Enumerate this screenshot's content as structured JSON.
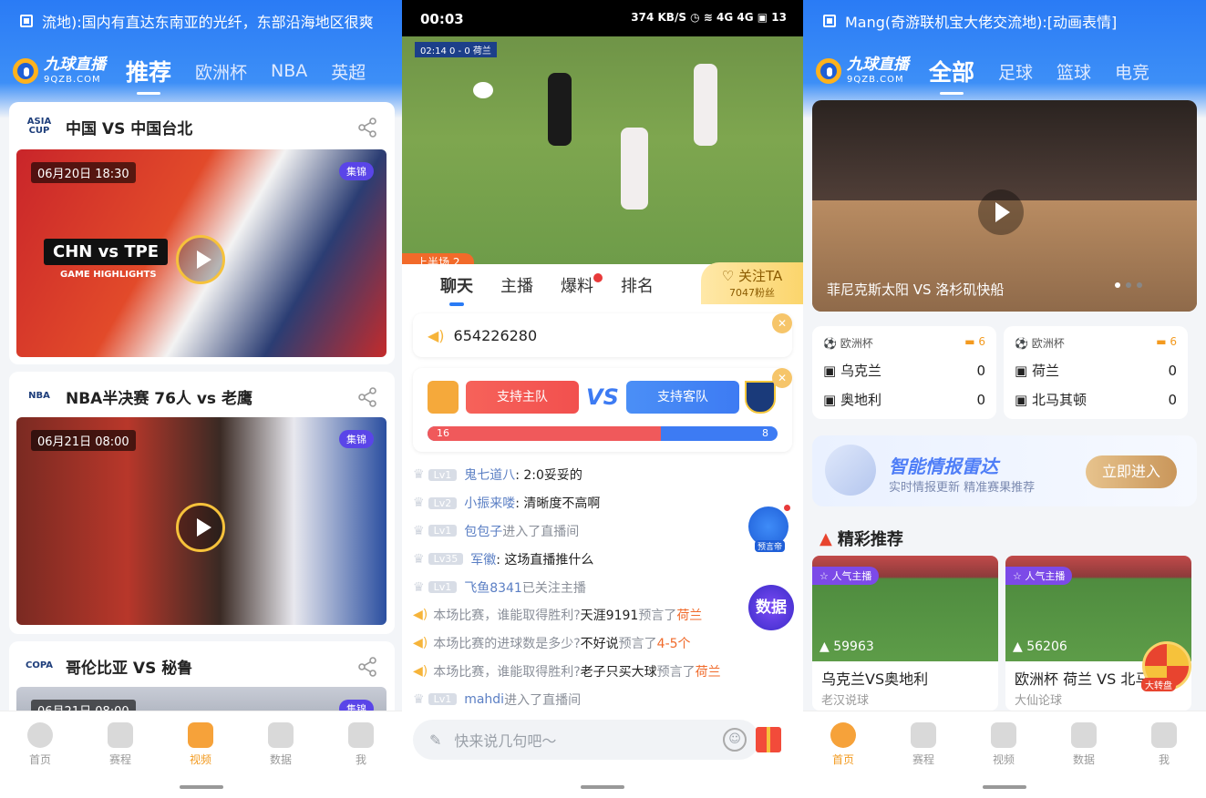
{
  "panel1": {
    "notice": "流地):国内有直达东南亚的光纤，东部沿海地区很爽",
    "logo_cn": "九球直播",
    "logo_en": "9QZB.COM",
    "tabs": [
      "推荐",
      "欧洲杯",
      "NBA",
      "英超"
    ],
    "cards": [
      {
        "league": "ASIA CUP",
        "title": "中国 VS 中国台北",
        "date": "06月20日 18:30",
        "badge": "集锦",
        "overlay": "CHN vs TPE",
        "overlay_sub": "GAME HIGHLIGHTS"
      },
      {
        "league": "NBA",
        "title": "NBA半决赛 76人 vs 老鹰",
        "date": "06月21日 08:00",
        "badge": "集锦"
      },
      {
        "league": "COPA",
        "title": "哥伦比亚 VS 秘鲁",
        "date": "06月21日 08:00",
        "badge": "集锦"
      }
    ],
    "tabbar": [
      "首页",
      "赛程",
      "视频",
      "数据",
      "我"
    ],
    "tabbar_active": "视频"
  },
  "panel2": {
    "time": "00:03",
    "status_right": "374 KB/S ◷ ≋ 4G 4G ▣ 13",
    "score_overlay": "02:14  0 - 0  荷兰",
    "half": "上半场 2",
    "tabs": [
      "聊天",
      "主播",
      "爆料",
      "排名"
    ],
    "follow": "关注TA",
    "fans": "7047粉丝",
    "announcement": "654226280",
    "vote": {
      "home": "支持主队",
      "away": "支持客队",
      "vs": "VS",
      "home_count": "16",
      "away_count": "8",
      "home_share": 0.667
    },
    "messages": [
      {
        "level": "Lv1",
        "user": "鬼七道八",
        "text": ": 2:0妥妥的"
      },
      {
        "level": "Lv2",
        "user": "小振来喽",
        "text": ": 清晰度不高啊"
      },
      {
        "level": "Lv1",
        "user": "包包子",
        "text": "进入了直播间",
        "sys": true
      },
      {
        "level": "Lv35",
        "user": "军徽",
        "text": ": 这场直播推什么"
      },
      {
        "level": "Lv1",
        "user": "飞鱼8341",
        "text": "已关注主播",
        "sys": true
      },
      {
        "pred": true,
        "q": "本场比赛，谁能取得胜利?",
        "user": "天涯9191",
        "mid": "预言了",
        "ans": "荷兰"
      },
      {
        "pred": true,
        "q": "本场比赛的进球数是多少?",
        "user": "不好说",
        "mid": "预言了",
        "ans": "4-5个"
      },
      {
        "pred": true,
        "q": "本场比赛，谁能取得胜利?",
        "user": "老子只买大球",
        "mid": "预言了",
        "ans": "荷兰"
      },
      {
        "level": "Lv1",
        "user": "mahdi",
        "text": "进入了直播间",
        "sys": true
      }
    ],
    "float1": "预言帝",
    "float2": "数据",
    "input_placeholder": "快来说几句吧～"
  },
  "panel3": {
    "notice": "Mang(奇游联机宝大佬交流地):[动画表情]",
    "tabs": [
      "全部",
      "足球",
      "篮球",
      "电竞"
    ],
    "hero_title": "菲尼克斯太阳 VS 洛杉矶快船",
    "matches": [
      {
        "league": "欧洲杯",
        "cam": "6",
        "home": "乌克兰",
        "home_score": "0",
        "away": "奥地利",
        "away_score": "0"
      },
      {
        "league": "欧洲杯",
        "cam": "6",
        "home": "荷兰",
        "home_score": "0",
        "away": "北马其顿",
        "away_score": "0"
      }
    ],
    "radar_title": "智能情报雷达",
    "radar_sub": "实时情报更新 精准赛果推荐",
    "radar_btn": "立即进入",
    "rec_title": "精彩推荐",
    "recs": [
      {
        "tag": "人气主播",
        "hot": "59963",
        "title": "乌克兰VS奥地利",
        "host": "老汉说球"
      },
      {
        "tag": "人气主播",
        "hot": "56206",
        "title": "欧洲杯 荷兰 VS 北马",
        "host": "大仙论球"
      }
    ],
    "wheel": "大转盘",
    "tabbar": [
      "首页",
      "赛程",
      "视频",
      "数据",
      "我"
    ]
  },
  "colors": {
    "brand_blue": "#2a7bf5",
    "accent_orange": "#f29a1f",
    "home_red": "#f0595b",
    "away_blue": "#3d7bf3"
  }
}
